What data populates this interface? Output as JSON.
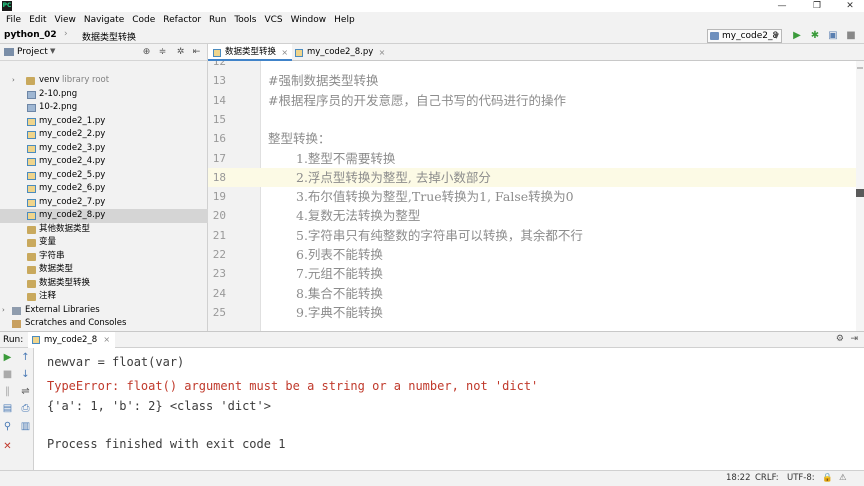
{
  "titlebar": {
    "logo_text": "PC",
    "minimize": "—",
    "maximize": "❐",
    "close": "✕"
  },
  "menu": [
    "File",
    "Edit",
    "View",
    "Navigate",
    "Code",
    "Refactor",
    "Run",
    "Tools",
    "VCS",
    "Window",
    "Help"
  ],
  "navbar": {
    "project": "python_02",
    "separator": "›",
    "current_file": "数据类型转换",
    "run_config": "my_code2_8"
  },
  "project_panel": {
    "title": "Project",
    "tree": [
      {
        "label": "venv",
        "extra": "library root",
        "icon": "folder",
        "indent": 1,
        "arrow": "›"
      },
      {
        "label": "2-10.png",
        "icon": "png",
        "indent": 2
      },
      {
        "label": "10-2.png",
        "icon": "png",
        "indent": 2
      },
      {
        "label": "my_code2_1.py",
        "icon": "py",
        "indent": 2
      },
      {
        "label": "my_code2_2.py",
        "icon": "py",
        "indent": 2
      },
      {
        "label": "my_code2_3.py",
        "icon": "py",
        "indent": 2
      },
      {
        "label": "my_code2_4.py",
        "icon": "py",
        "indent": 2
      },
      {
        "label": "my_code2_5.py",
        "icon": "py",
        "indent": 2
      },
      {
        "label": "my_code2_6.py",
        "icon": "py",
        "indent": 2
      },
      {
        "label": "my_code2_7.py",
        "icon": "py",
        "indent": 2
      },
      {
        "label": "my_code2_8.py",
        "icon": "py",
        "indent": 2,
        "selected": true
      },
      {
        "label": "其他数据类型",
        "icon": "pkg",
        "indent": 2
      },
      {
        "label": "变量",
        "icon": "pkg",
        "indent": 2
      },
      {
        "label": "字符串",
        "icon": "pkg",
        "indent": 2
      },
      {
        "label": "数据类型",
        "icon": "pkg",
        "indent": 2
      },
      {
        "label": "数据类型转换",
        "icon": "pkg",
        "indent": 2
      },
      {
        "label": "注释",
        "icon": "pkg",
        "indent": 2
      },
      {
        "label": "External Libraries",
        "icon": "lib",
        "indent": 0,
        "arrow": "›"
      },
      {
        "label": "Scratches and Consoles",
        "icon": "scratch",
        "indent": 0
      }
    ]
  },
  "editor": {
    "tabs": [
      {
        "label": "数据类型转换",
        "active": true
      },
      {
        "label": "my_code2_8.py",
        "active": false
      }
    ],
    "lines": [
      {
        "no": "12",
        "text": ""
      },
      {
        "no": "13",
        "text": "#强制数据类型转换"
      },
      {
        "no": "14",
        "text": "#根据程序员的开发意愿，自己书写的代码进行的操作"
      },
      {
        "no": "15",
        "text": ""
      },
      {
        "no": "16",
        "text": "整型转换："
      },
      {
        "no": "17",
        "text": "1.整型不需要转换",
        "sub": true
      },
      {
        "no": "18",
        "text": "2.浮点型转换为整型, 去掉小数部分",
        "sub": true,
        "current": true
      },
      {
        "no": "19",
        "text": "3.布尔值转换为整型,True转换为1, False转换为0",
        "sub": true
      },
      {
        "no": "20",
        "text": "4.复数无法转换为整型",
        "sub": true
      },
      {
        "no": "21",
        "text": "5.字符串只有纯整数的字符串可以转换，其余都不行",
        "sub": true
      },
      {
        "no": "22",
        "text": "6.列表不能转换",
        "sub": true
      },
      {
        "no": "23",
        "text": "7.元组不能转换",
        "sub": true
      },
      {
        "no": "24",
        "text": "8.集合不能转换",
        "sub": true
      },
      {
        "no": "25",
        "text": "9.字典不能转换",
        "sub": true
      }
    ]
  },
  "run_panel": {
    "label": "Run:",
    "tab": "my_code2_8",
    "settings_icon": "⚙",
    "hide_icon": "⇥",
    "console": [
      {
        "text": "    newvar = float(var)",
        "kind": "normal"
      },
      {
        "text": "TypeError: float() argument must be a string or a number, not 'dict'",
        "kind": "error"
      },
      {
        "text": "{'a': 1, 'b': 2} <class 'dict'>",
        "kind": "normal"
      },
      {
        "text": "",
        "kind": "normal"
      },
      {
        "text": "Process finished with exit code 1",
        "kind": "normal"
      }
    ]
  },
  "statusbar": {
    "position": "18:22",
    "line_sep": "CRLF:",
    "encoding": "UTF-8:",
    "icons": "🔒 ⚠"
  },
  "colors": {
    "accent": "#4083c9",
    "error": "#c0392b",
    "current_line": "#fcfae5",
    "run_green": "#4caf50"
  }
}
